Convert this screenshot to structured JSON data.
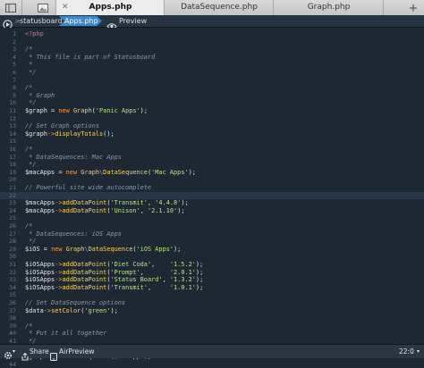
{
  "tabs": [
    {
      "label": "Apps.php",
      "active": true
    },
    {
      "label": "DataSequence.php",
      "active": false
    },
    {
      "label": "Graph.php",
      "active": false
    }
  ],
  "pathbar": {
    "crumbs": [
      "statusboard",
      "Apps.php"
    ],
    "preview_label": "Preview"
  },
  "code": {
    "lines": [
      [
        [
          "tag",
          "<?php"
        ]
      ],
      [],
      [
        [
          "comment",
          "/*"
        ]
      ],
      [
        [
          "comment",
          " * This file is part of Statusboard"
        ]
      ],
      [
        [
          "comment",
          " *"
        ]
      ],
      [
        [
          "comment",
          " */"
        ]
      ],
      [],
      [
        [
          "comment",
          "/*"
        ]
      ],
      [
        [
          "comment",
          " * Graph"
        ]
      ],
      [
        [
          "comment",
          " */"
        ]
      ],
      [
        [
          "var",
          "$graph"
        ],
        [
          "punc",
          " = "
        ],
        [
          "kw",
          "new"
        ],
        [
          "punc",
          " "
        ],
        [
          "cls",
          "Graph"
        ],
        [
          "punc",
          "("
        ],
        [
          "str",
          "'Panic Apps'"
        ],
        [
          "punc",
          ");"
        ]
      ],
      [],
      [
        [
          "comment",
          "// Set Graph options"
        ]
      ],
      [
        [
          "var",
          "$graph"
        ],
        [
          "op",
          "->"
        ],
        [
          "method",
          "displayTotals"
        ],
        [
          "punc",
          "();"
        ]
      ],
      [],
      [
        [
          "comment",
          "/*"
        ]
      ],
      [
        [
          "comment",
          " * DataSequences: Mac Apps"
        ]
      ],
      [
        [
          "comment",
          " */"
        ]
      ],
      [
        [
          "var",
          "$macApps"
        ],
        [
          "punc",
          " = "
        ],
        [
          "kw",
          "new"
        ],
        [
          "punc",
          " "
        ],
        [
          "cls",
          "Graph"
        ],
        [
          "ns",
          "\\"
        ],
        [
          "cls",
          "DataSequence"
        ],
        [
          "punc",
          "("
        ],
        [
          "str",
          "'Mac Apps'"
        ],
        [
          "punc",
          ");"
        ]
      ],
      [],
      [
        [
          "comment",
          "// Powerful site wide autocomplete"
        ]
      ],
      [],
      [
        [
          "var",
          "$macApps"
        ],
        [
          "op",
          "->"
        ],
        [
          "method",
          "addDataPoint"
        ],
        [
          "punc",
          "("
        ],
        [
          "str",
          "'Transmit'"
        ],
        [
          "punc",
          ", "
        ],
        [
          "str",
          "'4.4.8'"
        ],
        [
          "punc",
          ");"
        ]
      ],
      [
        [
          "var",
          "$macApps"
        ],
        [
          "op",
          "->"
        ],
        [
          "method",
          "addDataPoint"
        ],
        [
          "punc",
          "("
        ],
        [
          "str",
          "'Unison'"
        ],
        [
          "punc",
          ", "
        ],
        [
          "str",
          "'2.1.10'"
        ],
        [
          "punc",
          ");"
        ]
      ],
      [],
      [
        [
          "comment",
          "/*"
        ]
      ],
      [
        [
          "comment",
          " * DataSequences: iOS Apps"
        ]
      ],
      [
        [
          "comment",
          " */"
        ]
      ],
      [
        [
          "var",
          "$iOS"
        ],
        [
          "punc",
          " = "
        ],
        [
          "kw",
          "new"
        ],
        [
          "punc",
          " "
        ],
        [
          "cls",
          "Graph"
        ],
        [
          "ns",
          "\\"
        ],
        [
          "cls",
          "DataSequence"
        ],
        [
          "punc",
          "("
        ],
        [
          "str",
          "'iOS Apps'"
        ],
        [
          "punc",
          ");"
        ]
      ],
      [],
      [
        [
          "var",
          "$iOSApps"
        ],
        [
          "op",
          "->"
        ],
        [
          "method",
          "addDataPoint"
        ],
        [
          "punc",
          "("
        ],
        [
          "str",
          "'Diet Coda'"
        ],
        [
          "punc",
          ",    "
        ],
        [
          "str",
          "'1.5.2'"
        ],
        [
          "punc",
          ");"
        ]
      ],
      [
        [
          "var",
          "$iOSApps"
        ],
        [
          "op",
          "->"
        ],
        [
          "method",
          "addDataPoint"
        ],
        [
          "punc",
          "("
        ],
        [
          "str",
          "'Prompt'"
        ],
        [
          "punc",
          ",       "
        ],
        [
          "str",
          "'2.0.1'"
        ],
        [
          "punc",
          ");"
        ]
      ],
      [
        [
          "var",
          "$iOSApps"
        ],
        [
          "op",
          "->"
        ],
        [
          "method",
          "addDataPoint"
        ],
        [
          "punc",
          "("
        ],
        [
          "str",
          "'Status Board'"
        ],
        [
          "punc",
          ", "
        ],
        [
          "str",
          "'1.3.2'"
        ],
        [
          "punc",
          ");"
        ]
      ],
      [
        [
          "var",
          "$iOSApps"
        ],
        [
          "op",
          "->"
        ],
        [
          "method",
          "addDataPoint"
        ],
        [
          "punc",
          "("
        ],
        [
          "str",
          "'Transmit'"
        ],
        [
          "punc",
          ",     "
        ],
        [
          "str",
          "'1.0.1'"
        ],
        [
          "punc",
          ");"
        ]
      ],
      [],
      [
        [
          "comment",
          "// Set DataSequence options"
        ]
      ],
      [
        [
          "var",
          "$data"
        ],
        [
          "op",
          "->"
        ],
        [
          "method",
          "setColor"
        ],
        [
          "punc",
          "("
        ],
        [
          "str",
          "'green'"
        ],
        [
          "punc",
          ");"
        ]
      ],
      [],
      [
        [
          "comment",
          "/*"
        ]
      ],
      [
        [
          "comment",
          " * Put it all together"
        ]
      ],
      [
        [
          "comment",
          " */"
        ]
      ],
      [
        [
          "var",
          "$graph"
        ],
        [
          "op",
          "->"
        ],
        [
          "method",
          "addDataSequence"
        ],
        [
          "punc",
          "("
        ],
        [
          "var",
          "$macApps"
        ],
        [
          "punc",
          ");"
        ]
      ],
      [
        [
          "var",
          "$graph"
        ],
        [
          "op",
          "->"
        ],
        [
          "method",
          "addDataSequence"
        ],
        [
          "punc",
          "("
        ],
        [
          "var",
          "$iOSApps"
        ],
        [
          "punc",
          ");"
        ]
      ],
      []
    ],
    "highlighted_line": 22
  },
  "statusbar": {
    "share_label": "Share",
    "airpreview_label": "AirPreview",
    "position": "22:0"
  },
  "colors": {
    "accent": "#3a86d0",
    "editor_bg": "#1d2833"
  },
  "icons": [
    "sidebar-toggle-icon",
    "image-icon",
    "close-icon",
    "forward-circle-icon",
    "eye-icon",
    "gear-icon",
    "share-icon",
    "airpreview-icon"
  ]
}
